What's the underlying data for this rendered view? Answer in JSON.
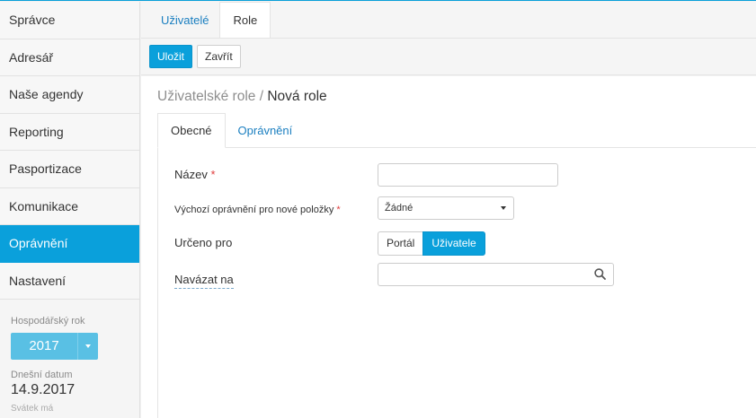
{
  "sidebar": {
    "items": [
      {
        "label": "Správce"
      },
      {
        "label": "Adresář"
      },
      {
        "label": "Naše agendy"
      },
      {
        "label": "Reporting"
      },
      {
        "label": "Pasportizace"
      },
      {
        "label": "Komunikace"
      },
      {
        "label": "Oprávnění",
        "active": true
      },
      {
        "label": "Nastavení"
      }
    ],
    "fiscal_year_label": "Hospodářský rok",
    "fiscal_year_value": "2017",
    "today_label": "Dnešní datum",
    "today_value": "14.9.2017",
    "name_day_label": "Svátek má"
  },
  "top_tabs": [
    {
      "label": "Uživatelé"
    },
    {
      "label": "Role",
      "active": true
    }
  ],
  "toolbar": {
    "save_label": "Uložit",
    "close_label": "Zavřít"
  },
  "breadcrumb": {
    "parent": "Uživatelské role",
    "separator": " / ",
    "current": "Nová role"
  },
  "sub_tabs": [
    {
      "label": "Obecné",
      "active": true
    },
    {
      "label": "Oprávnění"
    }
  ],
  "form": {
    "name_label": "Název",
    "name_value": "",
    "default_permission_label": "Výchozí oprávnění pro nové položky",
    "default_permission_value": "Žádné",
    "intended_for_label": "Určeno pro",
    "intended_for_options": [
      "Portál",
      "Uživatele"
    ],
    "intended_for_selected": "Uživatele",
    "link_to_label": "Navázat na",
    "link_to_value": "",
    "required_mark": "*"
  },
  "colors": {
    "accent": "#0aa0db",
    "link": "#1b7fc0",
    "required": "#e03d3d"
  }
}
